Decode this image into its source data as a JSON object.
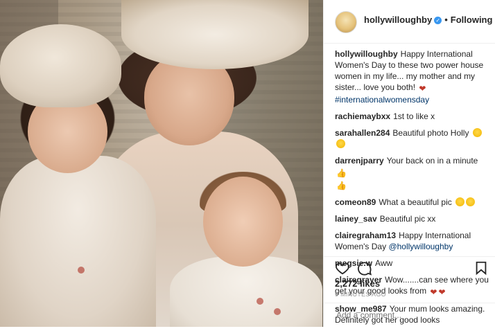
{
  "post": {
    "username": "hollywilloughby",
    "verified": true,
    "separator": "•",
    "follow_status": "Following"
  },
  "comments": [
    {
      "user": "hollywilloughby",
      "text": "Happy International Women's Day to these two power house women in my life... my mother and my sister... love you both! ",
      "emoji": "heart",
      "hashtag": "#internationalwomensday"
    },
    {
      "user": "rachiemaybxx",
      "text": "1st to like x"
    },
    {
      "user": "sarahallen284",
      "text": "Beautiful photo Holly",
      "emoji": "smile-smile"
    },
    {
      "user": "darrenjparry",
      "text": "Your back on in a minute",
      "emoji": "thumbs-up-thumbs-up"
    },
    {
      "user": "comeon89",
      "text": "What a beautiful pic",
      "emoji": "smile-smile"
    },
    {
      "user": "lainey_sav",
      "text": "Beautiful pic xx"
    },
    {
      "user": "clairegraham13",
      "text": "Happy International Women's Day",
      "mention": "@hollywilloughby"
    },
    {
      "user": "megsie.w",
      "text": "Aww"
    },
    {
      "user": "clairegrayer",
      "text": "Wow.......can see where you get your good looks from",
      "emoji": "heart-heart"
    },
    {
      "user": "show_me987",
      "text": "Your mum looks amazing. Definitely got her good looks"
    }
  ],
  "stats": {
    "likes": "2,272 likes",
    "time": "9 MINUTES AGO"
  },
  "add_comment": {
    "placeholder": "Add a comment..."
  },
  "icons": {
    "like": "heart-outline-icon",
    "comment": "comment-bubble-icon",
    "save": "bookmark-icon",
    "verified": "verified-badge-icon"
  },
  "colors": {
    "verified_blue": "#3897f0",
    "link_blue": "#003569",
    "text": "#262626",
    "muted": "#999999"
  }
}
